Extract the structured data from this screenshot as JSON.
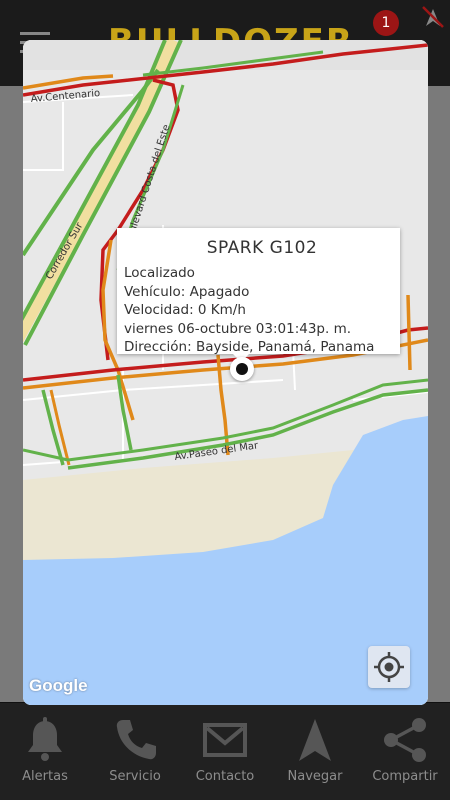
{
  "header": {
    "brand": "BULLDOZER",
    "notification_count": "1"
  },
  "popup": {
    "title": "SPARK G102",
    "lines": [
      "Localizado",
      "Vehículo: Apagado",
      "Velocidad: 0 Km/h",
      "viernes 06-octubre 03:01:43p. m.",
      "Dirección: Bayside, Panamá, Panama"
    ]
  },
  "map": {
    "roads": {
      "centenario": "Av.Centenario",
      "corredor": "Corredor Sur",
      "boulevard": "Boulevard Costa del Este",
      "paseo": "Av.Paseo del Mar"
    },
    "attribution": "Google",
    "colors": {
      "traffic_green": "#62b24a",
      "traffic_orange": "#e0891a",
      "traffic_red": "#c41c1c",
      "water": "#a7cdfb",
      "land": "#e8e8e8"
    }
  },
  "nav": {
    "items": [
      {
        "label": "Alertas",
        "icon": "bell-icon"
      },
      {
        "label": "Servicio",
        "icon": "phone-icon"
      },
      {
        "label": "Contacto",
        "icon": "mail-icon"
      },
      {
        "label": "Navegar",
        "icon": "navigate-icon"
      },
      {
        "label": "Compartir",
        "icon": "share-icon"
      }
    ]
  }
}
